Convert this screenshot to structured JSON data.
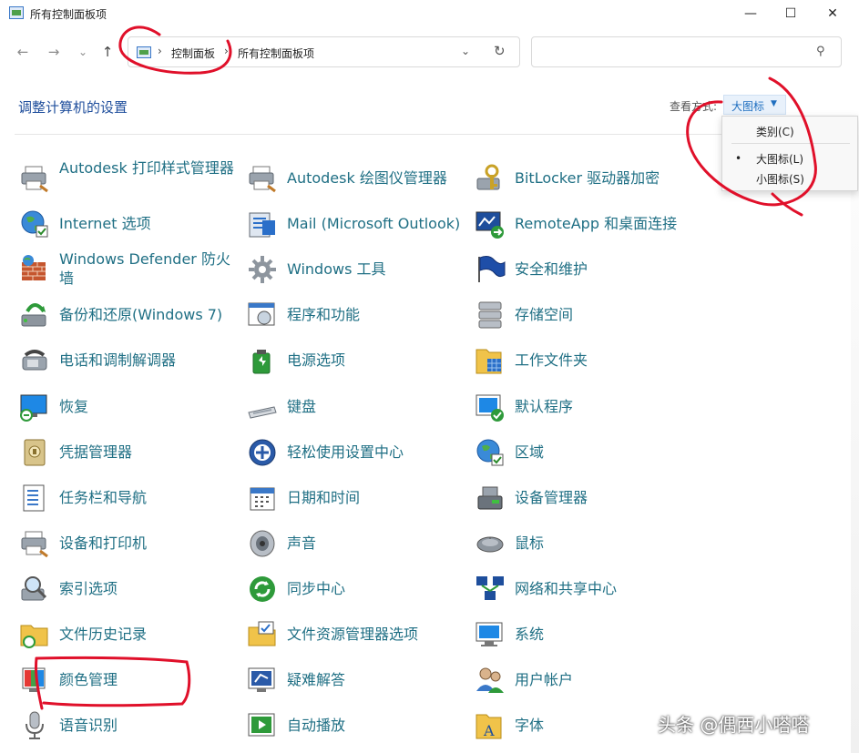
{
  "window": {
    "title": "所有控制面板项",
    "controls": {
      "minimize": "—",
      "maximize": "☐",
      "close": "✕"
    }
  },
  "nav": {
    "back": "←",
    "forward": "→",
    "recent": "⌄",
    "up": "↑"
  },
  "address": {
    "sep": "›",
    "segments": [
      "控制面板",
      "所有控制面板项"
    ],
    "dropdown": "⌄",
    "refresh": "↻"
  },
  "search": {
    "placeholder": "",
    "icon": "⚲"
  },
  "header": {
    "title": "调整计算机的设置",
    "view_label": "查看方式:",
    "view_value": "大图标",
    "view_caret": "▼"
  },
  "view_menu": {
    "items": [
      "类别(C)",
      "大图标(L)",
      "小图标(S)"
    ],
    "selected_bullet": "•"
  },
  "columns": [
    [
      {
        "label": "Autodesk 打印样式管理器",
        "icon": "printer-style-icon"
      },
      {
        "label": "Internet 选项",
        "icon": "internet-options-icon"
      },
      {
        "label": "Windows Defender 防火墙",
        "icon": "firewall-icon"
      },
      {
        "label": "备份和还原(Windows 7)",
        "icon": "backup-icon"
      },
      {
        "label": "电话和调制解调器",
        "icon": "phone-modem-icon"
      },
      {
        "label": "恢复",
        "icon": "recovery-icon"
      },
      {
        "label": "凭据管理器",
        "icon": "credential-icon"
      },
      {
        "label": "任务栏和导航",
        "icon": "taskbar-icon"
      },
      {
        "label": "设备和打印机",
        "icon": "devices-printers-icon"
      },
      {
        "label": "索引选项",
        "icon": "indexing-icon"
      },
      {
        "label": "文件历史记录",
        "icon": "file-history-icon"
      },
      {
        "label": "颜色管理",
        "icon": "color-management-icon"
      },
      {
        "label": "语音识别",
        "icon": "microphone-icon"
      }
    ],
    [
      {
        "label": "Autodesk 绘图仪管理器",
        "icon": "plotter-icon"
      },
      {
        "label": "Mail (Microsoft Outlook)",
        "icon": "mail-icon"
      },
      {
        "label": "Windows 工具",
        "icon": "windows-tools-icon"
      },
      {
        "label": "程序和功能",
        "icon": "programs-icon"
      },
      {
        "label": "电源选项",
        "icon": "power-icon"
      },
      {
        "label": "键盘",
        "icon": "keyboard-icon"
      },
      {
        "label": "轻松使用设置中心",
        "icon": "ease-of-access-icon"
      },
      {
        "label": "日期和时间",
        "icon": "calendar-icon"
      },
      {
        "label": "声音",
        "icon": "speaker-icon"
      },
      {
        "label": "同步中心",
        "icon": "sync-icon"
      },
      {
        "label": "文件资源管理器选项",
        "icon": "folder-options-icon"
      },
      {
        "label": "疑难解答",
        "icon": "troubleshoot-icon"
      },
      {
        "label": "自动播放",
        "icon": "autoplay-icon"
      }
    ],
    [
      {
        "label": "BitLocker 驱动器加密",
        "icon": "bitlocker-icon"
      },
      {
        "label": "RemoteApp 和桌面连接",
        "icon": "remoteapp-icon"
      },
      {
        "label": "安全和维护",
        "icon": "security-flag-icon"
      },
      {
        "label": "存储空间",
        "icon": "storage-icon"
      },
      {
        "label": "工作文件夹",
        "icon": "work-folders-icon"
      },
      {
        "label": "默认程序",
        "icon": "default-programs-icon"
      },
      {
        "label": "区域",
        "icon": "region-globe-icon"
      },
      {
        "label": "设备管理器",
        "icon": "device-manager-icon"
      },
      {
        "label": "鼠标",
        "icon": "mouse-icon"
      },
      {
        "label": "网络和共享中心",
        "icon": "network-icon"
      },
      {
        "label": "系统",
        "icon": "system-icon"
      },
      {
        "label": "用户帐户",
        "icon": "user-accounts-icon"
      },
      {
        "label": "字体",
        "icon": "fonts-icon"
      }
    ]
  ],
  "watermark": "头条 @偶西小嗒嗒",
  "colors": {
    "link": "#1f6f84",
    "title": "#1f4e9c",
    "annotation": "#e0102a"
  }
}
